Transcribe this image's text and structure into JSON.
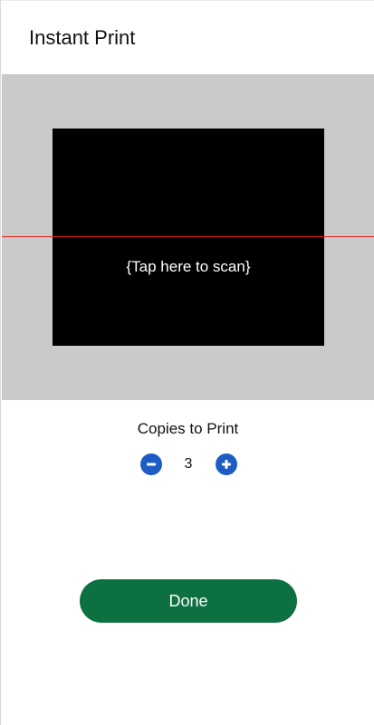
{
  "header": {
    "title": "Instant Print"
  },
  "scanner": {
    "prompt": "{Tap here to scan}"
  },
  "copies": {
    "label": "Copies to Print",
    "value": "3",
    "minus_icon": "minus-icon",
    "plus_icon": "plus-icon",
    "button_color": "#1e5bc3"
  },
  "actions": {
    "done_label": "Done",
    "done_color": "#0d7040"
  },
  "colors": {
    "scan_area_bg": "#cacaca",
    "scan_window_bg": "#000000",
    "scan_line": "#e2201b"
  }
}
